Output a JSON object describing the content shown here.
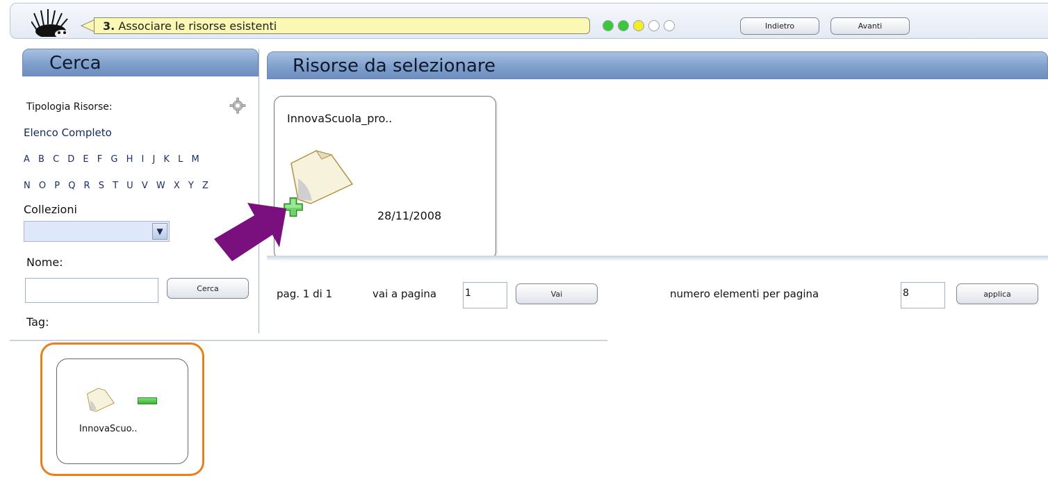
{
  "wizard": {
    "step_number": "3.",
    "step_title": "Associare le risorse esistenti",
    "back_label": "Indietro",
    "next_label": "Avanti",
    "progress_dots": [
      {
        "state": "done",
        "color": "#3cc63c"
      },
      {
        "state": "done",
        "color": "#3cc63c"
      },
      {
        "state": "current",
        "color": "#f3ec2a"
      },
      {
        "state": "todo",
        "color": "#ffffff"
      },
      {
        "state": "todo",
        "color": "#ffffff"
      }
    ]
  },
  "search_panel": {
    "title": "Cerca",
    "resource_type_label": "Tipologia Risorse:",
    "full_list_link": "Elenco Completo",
    "letters_row1": "A B C D E F G H I J K L M",
    "letters_row2": "N O P Q R S T U V W X Y Z",
    "collections_label": "Collezioni",
    "collections_selected": "",
    "name_label": "Nome:",
    "name_value": "",
    "search_button": "Cerca",
    "tag_label": "Tag:"
  },
  "results_panel": {
    "title": "Risorse da selezionare",
    "resources": [
      {
        "name": "InnovaScuola_pro..",
        "date": "28/11/2008"
      }
    ],
    "pager": {
      "page_text": "pag. 1 di 1",
      "goto_label": "vai a pagina",
      "goto_value": "1",
      "goto_button": "Vai",
      "per_page_label": "numero elementi per pagina",
      "per_page_value": "8",
      "apply_button": "applica"
    }
  },
  "selected_resources": [
    {
      "name": "InnovaScuo.."
    }
  ],
  "colors": {
    "header_blue": "#7f9fcc",
    "highlight_orange": "#f07b1a",
    "arrow_purple": "#7a0f7e",
    "bubble_yellow": "#fbf8b4"
  }
}
